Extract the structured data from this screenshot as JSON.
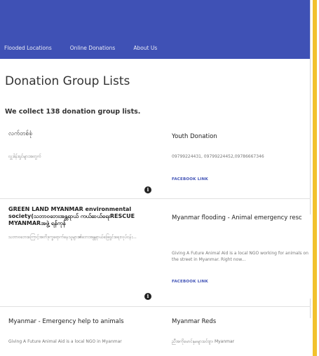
{
  "nav": {
    "links": [
      "Flooded Locations",
      "Online Donations",
      "About Us"
    ]
  },
  "page": {
    "title": "Donation Group Lists",
    "summary": "We collect 138 donation group lists."
  },
  "cards": [
    {
      "title": "လက်တစ်စုံ",
      "desc": "လှူဒါန်းရှင်များအတွက်",
      "link": ""
    },
    {
      "title": "Youth Donation",
      "desc": "09799224431, 09799224452,09786667346",
      "link": "FACEBOOK LINK"
    },
    {
      "title": "GREEN LAND MYANMAR environmental society(သဘာဝဘေးအန္တရာယ် ကယ်ဆယ်ရေးRESCUE MYANMARအဖွဲ့ ရန်ကုန်",
      "desc": "သဘာဝဘေးကြောင့်အတိဒုက္ခရောက်နေသူများ၏ဘေးအန္တရာယ်ဖြေရှင်းရေးလုပ်ငန်း...",
      "link": ""
    },
    {
      "title": "Myanmar flooding - Animal emergency resc",
      "desc": "Giving A Future Animal Aid is a local NGO working for animals on the street in Myanmar. Right now...",
      "link": "FACEBOOK LINK"
    },
    {
      "title": "Myanmar - Emergency help to animals",
      "desc": "Giving A Future Animal Aid is a local NGO in Myanmar",
      "link": ""
    },
    {
      "title": "Myanmar Reds",
      "desc": "ညီအကိုမောင်နှမများခင်ဗျာ၊ Myanmar",
      "link": ""
    }
  ],
  "colors": {
    "nav_bg": "#3f51b5",
    "link": "#3f51b5",
    "accent_edge": "#f2c12e"
  }
}
